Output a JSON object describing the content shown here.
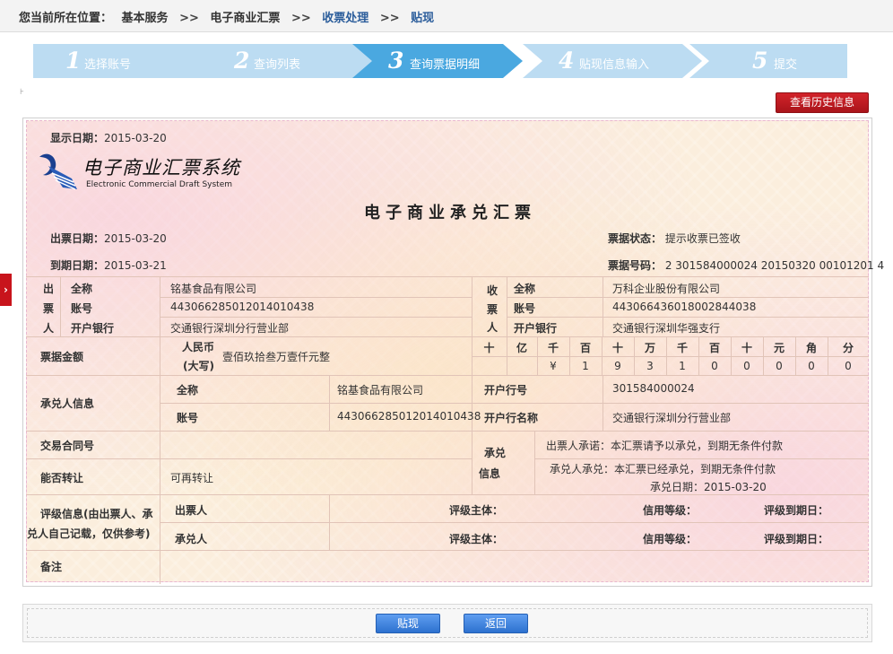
{
  "breadcrumb": {
    "prefix": "您当前所在位置：",
    "items": [
      "基本服务",
      "电子商业汇票",
      "收票处理",
      "贴现"
    ],
    "separator": ">>"
  },
  "steps": [
    {
      "num": "1",
      "label": "选择账号",
      "active": false
    },
    {
      "num": "2",
      "label": "查询列表",
      "active": false
    },
    {
      "num": "3",
      "label": "查询票据明细",
      "active": true
    },
    {
      "num": "4",
      "label": "贴现信息输入",
      "active": false
    },
    {
      "num": "5",
      "label": "提交",
      "active": false
    }
  ],
  "history_button": "查看历史信息",
  "side_tab_icon": "›",
  "draft": {
    "display_date_label": "显示日期：",
    "display_date": "2015-03-20",
    "logo_cn": "电子商业汇票系统",
    "logo_en": "Electronic Commercial Draft System",
    "title": "电子商业承兑汇票",
    "issue_date_label": "出票日期：",
    "issue_date": "2015-03-20",
    "due_date_label": "到期日期：",
    "due_date": "2015-03-21",
    "status_label": "票据状态：",
    "status": "提示收票已签收",
    "number_label": "票据号码：",
    "number": "2 301584000024 20150320 00101201 4",
    "drawer": {
      "chars": [
        "出",
        "票",
        "人"
      ],
      "fullname_label": "全称",
      "fullname": "铭基食品有限公司",
      "account_label": "账号",
      "account": "443066285012014010438",
      "bank_label": "开户银行",
      "bank": "交通银行深圳分行营业部"
    },
    "payee": {
      "chars": [
        "收",
        "票",
        "人"
      ],
      "fullname_label": "全称",
      "fullname": "万科企业股份有限公司",
      "account_label": "账号",
      "account": "443066436018002844038",
      "bank_label": "开户银行",
      "bank": "交通银行深圳华强支行"
    },
    "amount": {
      "label": "票据金额",
      "currency_label_1": "人民币",
      "currency_label_2": "(大写)",
      "in_words": "壹佰玖拾叁万壹仟元整",
      "units": [
        "十",
        "亿",
        "千",
        "百",
        "十",
        "万",
        "千",
        "百",
        "十",
        "元",
        "角",
        "分"
      ],
      "digits": [
        "",
        "",
        "¥",
        "1",
        "9",
        "3",
        "1",
        "0",
        "0",
        "0",
        "0",
        "0"
      ]
    },
    "acceptor": {
      "label": "承兑人信息",
      "fullname_label": "全称",
      "fullname": "铭基食品有限公司",
      "account_label": "账号",
      "account": "443066285012014010438",
      "bank_no_label": "开户行号",
      "bank_no": "301584000024",
      "bank_name_label": "开户行名称",
      "bank_name": "交通银行深圳分行营业部"
    },
    "contract_label": "交易合同号",
    "contract_value": "",
    "transferable_label": "能否转让",
    "transferable": "可再转让",
    "acceptance_info": {
      "label_1": "承兑",
      "label_2": "信息",
      "drawer_promise": "出票人承诺：本汇票请予以承兑，到期无条件付款",
      "acceptor_promise": "承兑人承兑：本汇票已经承兑，到期无条件付款",
      "accept_date_label": "承兑日期：",
      "accept_date": "2015-03-20"
    },
    "rating": {
      "label_1": "评级信息(由出票人、承",
      "label_2": "兑人自己记载，仅供参考)",
      "rows": [
        {
          "role": "出票人",
          "subject_label": "评级主体：",
          "level_label": "信用等级：",
          "expiry_label": "评级到期日："
        },
        {
          "role": "承兑人",
          "subject_label": "评级主体：",
          "level_label": "信用等级：",
          "expiry_label": "评级到期日："
        }
      ]
    },
    "remark_label": "备注",
    "remark": ""
  },
  "buttons": {
    "discount": "贴现",
    "back": "返回"
  },
  "colors": {
    "step_active": "#4aa8e0",
    "step_inactive": "#bcdcf2",
    "red": "#c8141c",
    "blue_btn": "#3a7fdd",
    "breadcrumb_current": "#2b5d9b"
  }
}
